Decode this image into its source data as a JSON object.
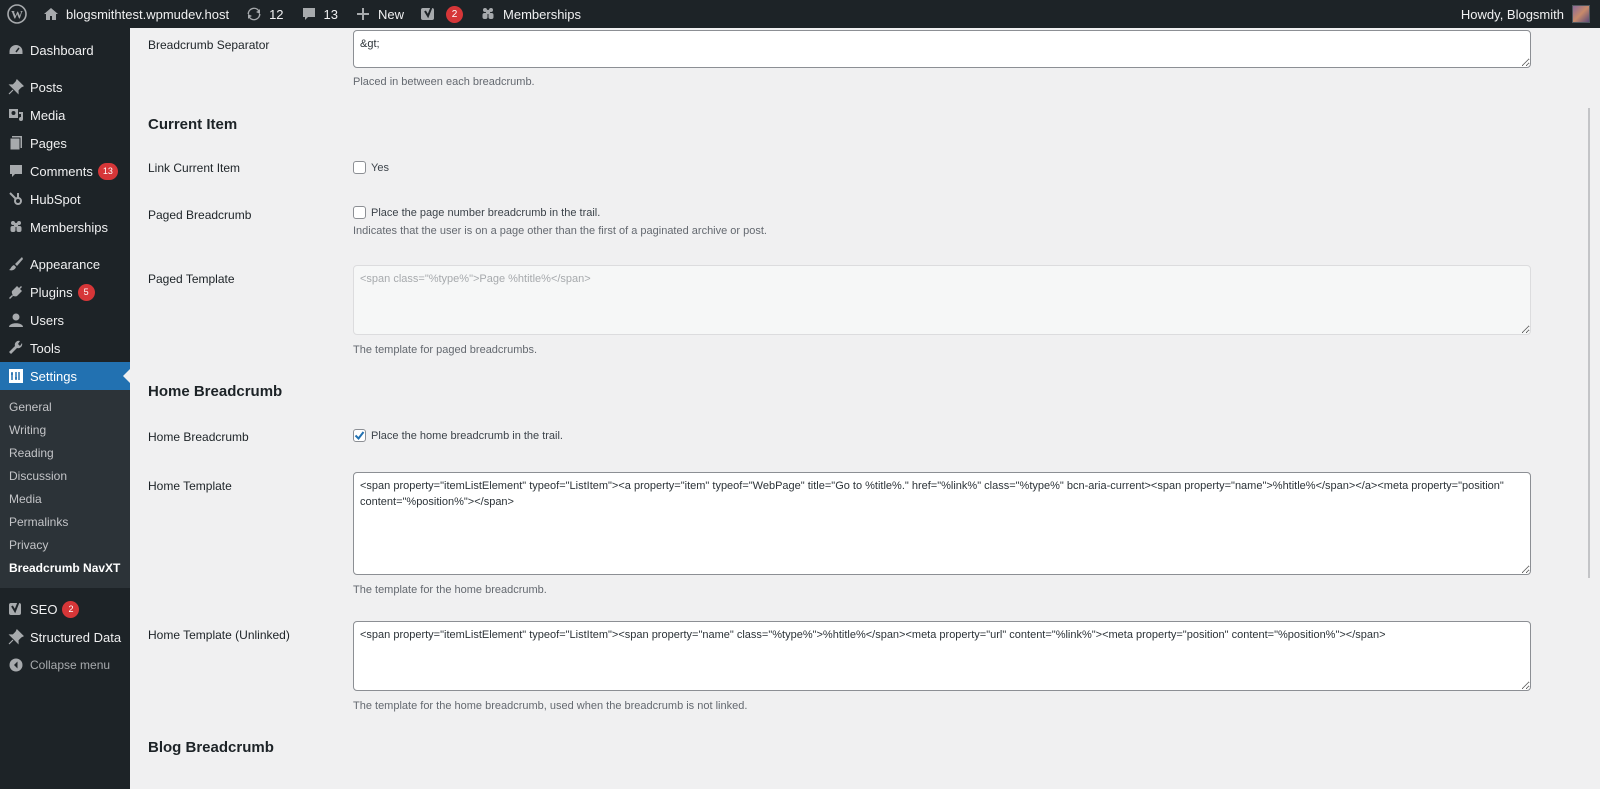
{
  "adminbar": {
    "site_name": "blogsmithtest.wpmudev.host",
    "updates_count": "12",
    "comments_count": "13",
    "new_label": "New",
    "seo_badge": "2",
    "memberships_label": "Memberships",
    "howdy": "Howdy, Blogsmith"
  },
  "sidebar": {
    "items": [
      {
        "label": "Dashboard",
        "icon": "dashboard-icon"
      },
      {
        "label": "Posts",
        "icon": "pin-icon"
      },
      {
        "label": "Media",
        "icon": "media-icon"
      },
      {
        "label": "Pages",
        "icon": "pages-icon"
      },
      {
        "label": "Comments",
        "icon": "comment-icon",
        "badge": "13"
      },
      {
        "label": "HubSpot",
        "icon": "hubspot-icon"
      },
      {
        "label": "Memberships",
        "icon": "memberships-icon"
      },
      {
        "label": "Appearance",
        "icon": "brush-icon"
      },
      {
        "label": "Plugins",
        "icon": "plugin-icon",
        "badge": "5"
      },
      {
        "label": "Users",
        "icon": "user-icon"
      },
      {
        "label": "Tools",
        "icon": "wrench-icon"
      },
      {
        "label": "Settings",
        "icon": "settings-icon",
        "active": true
      }
    ],
    "submenu": [
      "General",
      "Writing",
      "Reading",
      "Discussion",
      "Media",
      "Permalinks",
      "Privacy",
      "Breadcrumb NavXT"
    ],
    "submenu_current": "Breadcrumb NavXT",
    "bottom_items": [
      {
        "label": "SEO",
        "icon": "yoast-icon",
        "badge": "2"
      },
      {
        "label": "Structured Data",
        "icon": "pin-icon"
      }
    ],
    "collapse_label": "Collapse menu"
  },
  "content": {
    "separator": {
      "label": "Breadcrumb Separator",
      "value": "&gt;",
      "description": "Placed in between each breadcrumb."
    },
    "current_item": {
      "heading": "Current Item",
      "link_label": "Link Current Item",
      "link_checkbox_label": "Yes",
      "link_checked": false,
      "paged_label": "Paged Breadcrumb",
      "paged_checkbox_label": "Place the page number breadcrumb in the trail.",
      "paged_checked": false,
      "paged_description": "Indicates that the user is on a page other than the first of a paginated archive or post.",
      "paged_template_label": "Paged Template",
      "paged_template_value": "<span class=\"%type%\">Page %htitle%</span>",
      "paged_template_description": "The template for paged breadcrumbs."
    },
    "home": {
      "heading": "Home Breadcrumb",
      "home_label": "Home Breadcrumb",
      "home_checkbox_label": "Place the home breadcrumb in the trail.",
      "home_checked": true,
      "template_label": "Home Template",
      "template_value": "<span property=\"itemListElement\" typeof=\"ListItem\"><a property=\"item\" typeof=\"WebPage\" title=\"Go to %title%.\" href=\"%link%\" class=\"%type%\" bcn-aria-current><span property=\"name\">%htitle%</span></a><meta property=\"position\" content=\"%position%\"></span>",
      "template_description": "The template for the home breadcrumb.",
      "unlinked_label": "Home Template (Unlinked)",
      "unlinked_value": "<span property=\"itemListElement\" typeof=\"ListItem\"><span property=\"name\" class=\"%type%\">%htitle%</span><meta property=\"url\" content=\"%link%\"><meta property=\"position\" content=\"%position%\"></span>",
      "unlinked_description": "The template for the home breadcrumb, used when the breadcrumb is not linked."
    },
    "blog": {
      "heading": "Blog Breadcrumb"
    }
  },
  "colors": {
    "adminbar_bg": "#1d2327",
    "accent": "#2271b1",
    "badge": "#d63638",
    "content_bg": "#f0f0f1"
  }
}
